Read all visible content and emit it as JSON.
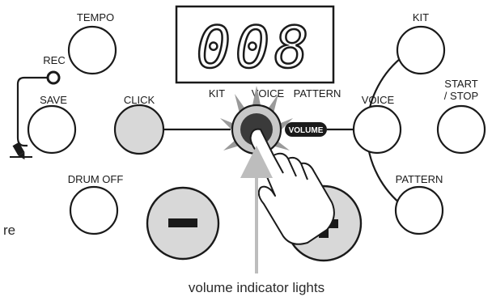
{
  "display": {
    "digits": "008",
    "labels": {
      "kit": "KIT",
      "voice": "VOICE",
      "pattern": "PATTERN"
    }
  },
  "buttons": {
    "tempo": "TEMPO",
    "rec": "REC",
    "save": "SAVE",
    "click": "CLICK",
    "drum_off": "DRUM OFF",
    "kit": "KIT",
    "voice": "VOICE",
    "start_stop_line1": "START",
    "start_stop_line2": "/ STOP",
    "pattern": "PATTERN",
    "minus": "−",
    "plus": "+"
  },
  "knob": {
    "label": "VOLUME"
  },
  "edge_text": "re",
  "caption": "volume indicator lights",
  "colors": {
    "ink": "#1a1a1a",
    "pad_grey": "#d8d8d8",
    "knob_dark": "#3a3a3a",
    "indicator_arrow": "#bdbdbd"
  },
  "icons": {
    "tap_hand": "pointing-hand-icon",
    "pencil": "pencil-icon"
  }
}
